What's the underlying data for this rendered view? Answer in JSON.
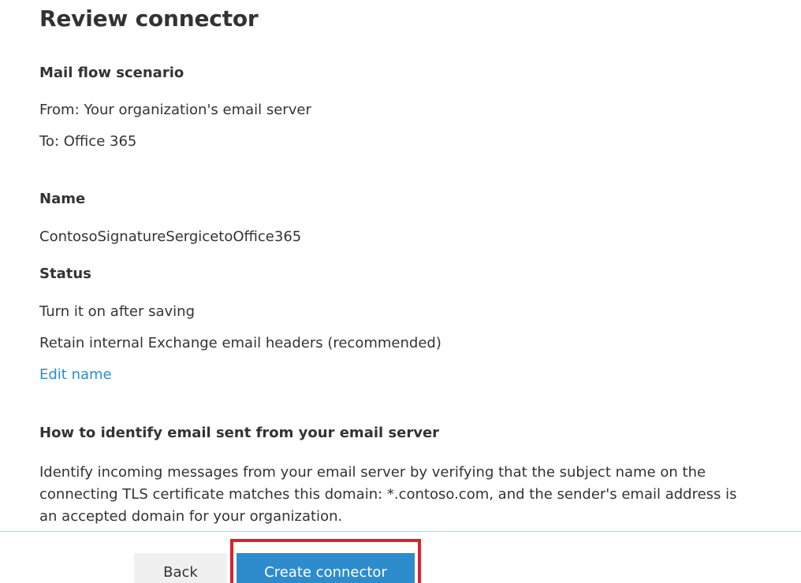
{
  "page": {
    "title": "Review connector"
  },
  "mail_flow": {
    "heading": "Mail flow scenario",
    "from": "From: Your organization's email server",
    "to": "To: Office 365"
  },
  "name_section": {
    "heading": "Name",
    "value": "ContosoSignatureSergicetoOffice365"
  },
  "status_section": {
    "heading": "Status",
    "line1": "Turn it on after saving",
    "line2": "Retain internal Exchange email headers (recommended)",
    "edit_link": "Edit name"
  },
  "identify_section": {
    "heading": "How to identify email sent from your email server",
    "body": "Identify incoming messages from your email server by verifying that the subject name on the connecting TLS certificate matches this domain: *.contoso.com, and the sender's email address is an accepted domain for your organization."
  },
  "footer": {
    "back_label": "Back",
    "create_label": "Create connector"
  },
  "colors": {
    "accent": "#2f8ccc",
    "link": "#2a8dd4",
    "highlight": "#e0202e"
  }
}
